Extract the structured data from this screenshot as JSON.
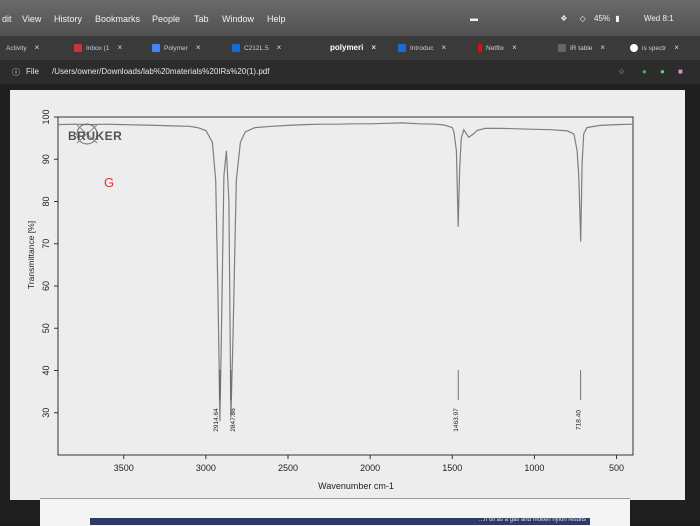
{
  "menubar": {
    "items": [
      "dit",
      "View",
      "History",
      "Bookmarks",
      "People",
      "Tab",
      "Window",
      "Help"
    ],
    "battery": "45%",
    "clock": "Wed 8:1"
  },
  "tabs": [
    {
      "label": "Activity",
      "active": false
    },
    {
      "label": "Inbox (1",
      "active": false
    },
    {
      "label": "Polymer",
      "active": false
    },
    {
      "label": "C212L.5",
      "active": false
    },
    {
      "label": "polymeri",
      "active": true
    },
    {
      "label": "Introduc",
      "active": false
    },
    {
      "label": "Netflix",
      "active": false
    },
    {
      "label": "IR table",
      "active": false
    },
    {
      "label": "is spectr",
      "active": false
    }
  ],
  "address": {
    "prefix": "File",
    "url": "/Users/owner/Downloads/lab%20materials%20IRs%20(1).pdf"
  },
  "document": {
    "logo": "BRUKER",
    "sample_letter": "G",
    "footer_text": "...n oil as a gas and molten nylon results"
  },
  "chart_data": {
    "type": "line",
    "title": "",
    "xlabel": "Wavenumber cm-1",
    "ylabel": "Transmittance [%]",
    "xlim": [
      3900,
      400
    ],
    "ylim": [
      20,
      100
    ],
    "x_ticks": [
      3500,
      3000,
      2500,
      2000,
      1500,
      1000,
      500
    ],
    "x_tick_labels": [
      "3500",
      "3000",
      "2500",
      "2000",
      "1500",
      "1000",
      "500"
    ],
    "y_ticks": [
      30,
      40,
      50,
      60,
      70,
      80,
      90,
      100
    ],
    "y_tick_labels": [
      "30",
      "40",
      "50",
      "60",
      "70",
      "80",
      "90",
      "100"
    ],
    "series": [
      {
        "x": [
          3900,
          3800,
          3700,
          3600,
          3500,
          3400,
          3300,
          3200,
          3100,
          3050,
          3000,
          2960,
          2940,
          2925,
          2914.64,
          2905,
          2890,
          2875,
          2860,
          2847.86,
          2835,
          2815,
          2790,
          2760,
          2700,
          2600,
          2500,
          2400,
          2300,
          2200,
          2100,
          2000,
          1900,
          1800,
          1700,
          1600,
          1550,
          1500,
          1490,
          1475,
          1463.97,
          1455,
          1445,
          1430,
          1400,
          1370,
          1350,
          1300,
          1200,
          1100,
          1000,
          900,
          800,
          760,
          740,
          730,
          718.4,
          710,
          700,
          680,
          600,
          500,
          400
        ],
        "y": [
          98.2,
          98.3,
          98.2,
          98.3,
          98.2,
          98.1,
          98,
          97.9,
          97.8,
          97.5,
          96.8,
          94,
          85,
          55,
          28,
          50,
          86,
          92,
          80,
          29,
          48,
          85,
          94,
          96.5,
          97.5,
          97.8,
          98,
          98.2,
          98.3,
          98.3,
          98.4,
          98.4,
          98.5,
          98.6,
          98.4,
          98.3,
          98.1,
          97.5,
          96.5,
          92,
          74,
          88,
          95,
          97,
          95.2,
          96,
          96.8,
          97.3,
          97.3,
          97.2,
          97.1,
          97,
          96.7,
          96,
          92,
          86,
          70.5,
          89,
          96,
          97.5,
          98,
          98.2,
          98.3
        ]
      }
    ],
    "annotations": [
      {
        "x": 2914.64,
        "label": "2914.64"
      },
      {
        "x": 2847.86,
        "label": "2847.86"
      },
      {
        "x": 1463.97,
        "label": "1463.97"
      },
      {
        "x": 718.4,
        "label": "718.40"
      }
    ],
    "colors": {
      "line": "#7f7f7f",
      "frame": "#333333",
      "logo_red": "#d9342b"
    }
  }
}
